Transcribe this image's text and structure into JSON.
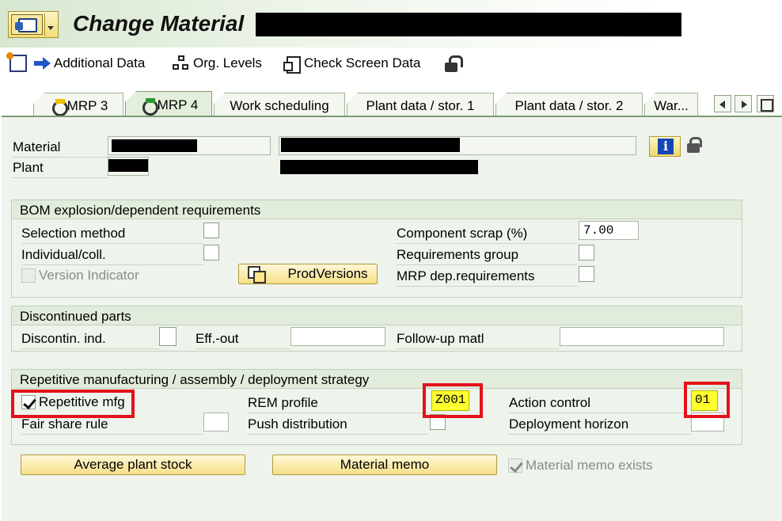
{
  "title_bar": {
    "title": "Change Material",
    "menu_icon": "sap-menu-icon"
  },
  "toolbar": {
    "create_icon": "create-icon",
    "additional_data": "Additional Data",
    "org_levels": "Org. Levels",
    "check_screen_data": "Check Screen Data",
    "lock_icon": "lock-icon"
  },
  "tabs": [
    {
      "label": "MRP 3",
      "icon": "mrp-icon",
      "active": false
    },
    {
      "label": "MRP 4",
      "icon": "mrp-check-icon",
      "active": true
    },
    {
      "label": "Work scheduling",
      "active": false
    },
    {
      "label": "Plant data / stor. 1",
      "active": false
    },
    {
      "label": "Plant data / stor. 2",
      "active": false
    },
    {
      "label": "War...",
      "active": false
    }
  ],
  "header": {
    "material_label": "Material",
    "plant_label": "Plant"
  },
  "bom": {
    "title": "BOM explosion/dependent requirements",
    "selection_method": "Selection method",
    "individual_coll": "Individual/coll.",
    "version_indicator": "Version Indicator",
    "prod_versions_button": "ProdVersions",
    "component_scrap": "Component scrap (%)",
    "component_scrap_value": "7.00",
    "requirements_group": "Requirements group",
    "mrp_dep_requirements": "MRP dep.requirements"
  },
  "discontinued": {
    "title": "Discontinued parts",
    "discontin_ind": "Discontin. ind.",
    "eff_out": "Eff.-out",
    "follow_up_matl": "Follow-up matl"
  },
  "repetitive": {
    "title": "Repetitive manufacturing / assembly / deployment strategy",
    "repetitive_mfg": "Repetitive mfg",
    "repetitive_mfg_checked": true,
    "fair_share_rule": "Fair share rule",
    "rem_profile": "REM profile",
    "rem_profile_value": "Z001",
    "push_distribution": "Push distribution",
    "action_control": "Action control",
    "action_control_value": "01",
    "deployment_horizon": "Deployment horizon"
  },
  "footer": {
    "average_plant_stock_button": "Average plant stock",
    "material_memo_button": "Material memo",
    "material_memo_exists": "Material memo exists",
    "material_memo_exists_checked": true
  },
  "colors": {
    "highlight_box": "#e3121b",
    "highlight_fill": "#ffff2e",
    "panel_bg": "#eef4ec"
  }
}
